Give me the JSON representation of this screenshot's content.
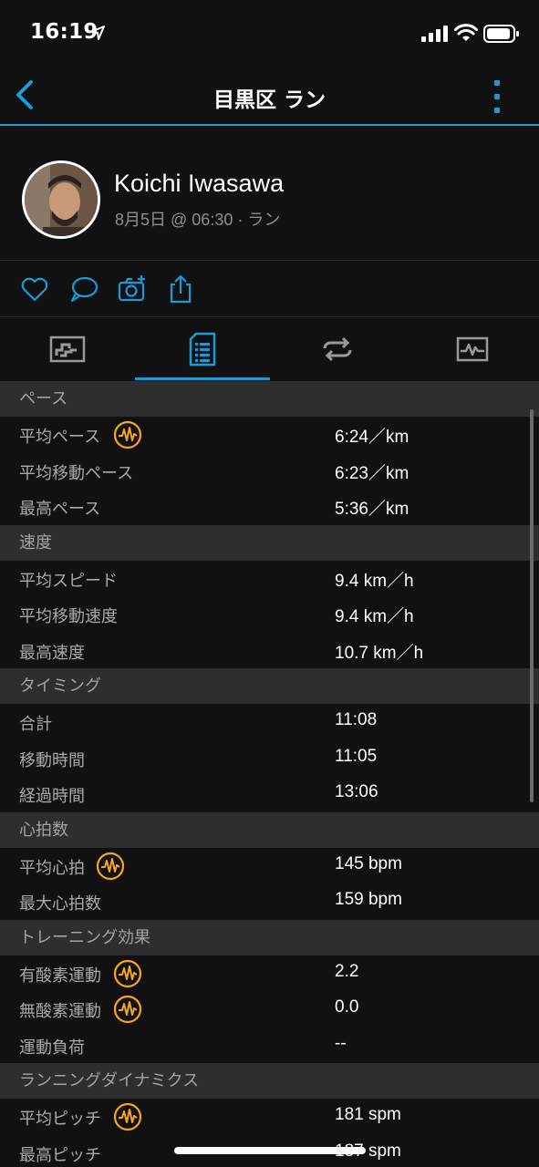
{
  "status_bar": {
    "time": "16:19"
  },
  "nav": {
    "title": "目黒区 ラン"
  },
  "profile": {
    "name": "Koichi Iwasawa",
    "meta": "8月5日 @ 06:30 · ラン"
  },
  "colors": {
    "accent": "#1a9bd7",
    "badge": "#f5a623",
    "background": "#111111",
    "section": "#2e2e2e"
  },
  "actions": [
    "heart-icon",
    "comment-icon",
    "add-photo-icon",
    "share-icon"
  ],
  "tabs": [
    "chart-tab-icon",
    "stats-tab-icon",
    "laps-tab-icon",
    "graph-tab-icon"
  ],
  "stats": {
    "pace": {
      "header": "ペース",
      "avg_pace": {
        "label": "平均ペース",
        "value": "6:24／km"
      },
      "avg_moving_pace": {
        "label": "平均移動ペース",
        "value": "6:23／km"
      },
      "best_pace": {
        "label": "最高ペース",
        "value": "5:36／km"
      }
    },
    "speed": {
      "header": "速度",
      "avg_speed": {
        "label": "平均スピード",
        "value": "9.4 km／h"
      },
      "avg_moving_speed": {
        "label": "平均移動速度",
        "value": "9.4 km／h"
      },
      "max_speed": {
        "label": "最高速度",
        "value": "10.7 km／h"
      }
    },
    "timing": {
      "header": "タイミング",
      "total": {
        "label": "合計",
        "value": "11:08"
      },
      "moving_time": {
        "label": "移動時間",
        "value": "11:05"
      },
      "elapsed_time": {
        "label": "経過時間",
        "value": "13:06"
      }
    },
    "heart_rate": {
      "header": "心拍数",
      "avg_hr": {
        "label": "平均心拍",
        "value": "145 bpm"
      },
      "max_hr": {
        "label": "最大心拍数",
        "value": "159 bpm"
      }
    },
    "training_effect": {
      "header": "トレーニング効果",
      "aerobic": {
        "label": "有酸素運動",
        "value": "2.2"
      },
      "anaerobic": {
        "label": "無酸素運動",
        "value": "0.0"
      },
      "load": {
        "label": "運動負荷",
        "value": "--"
      }
    },
    "running_dynamics": {
      "header": "ランニングダイナミクス",
      "avg_cadence": {
        "label": "平均ピッチ",
        "value": "181 spm"
      },
      "max_cadence": {
        "label": "最高ピッチ",
        "value": "187 spm"
      }
    }
  }
}
